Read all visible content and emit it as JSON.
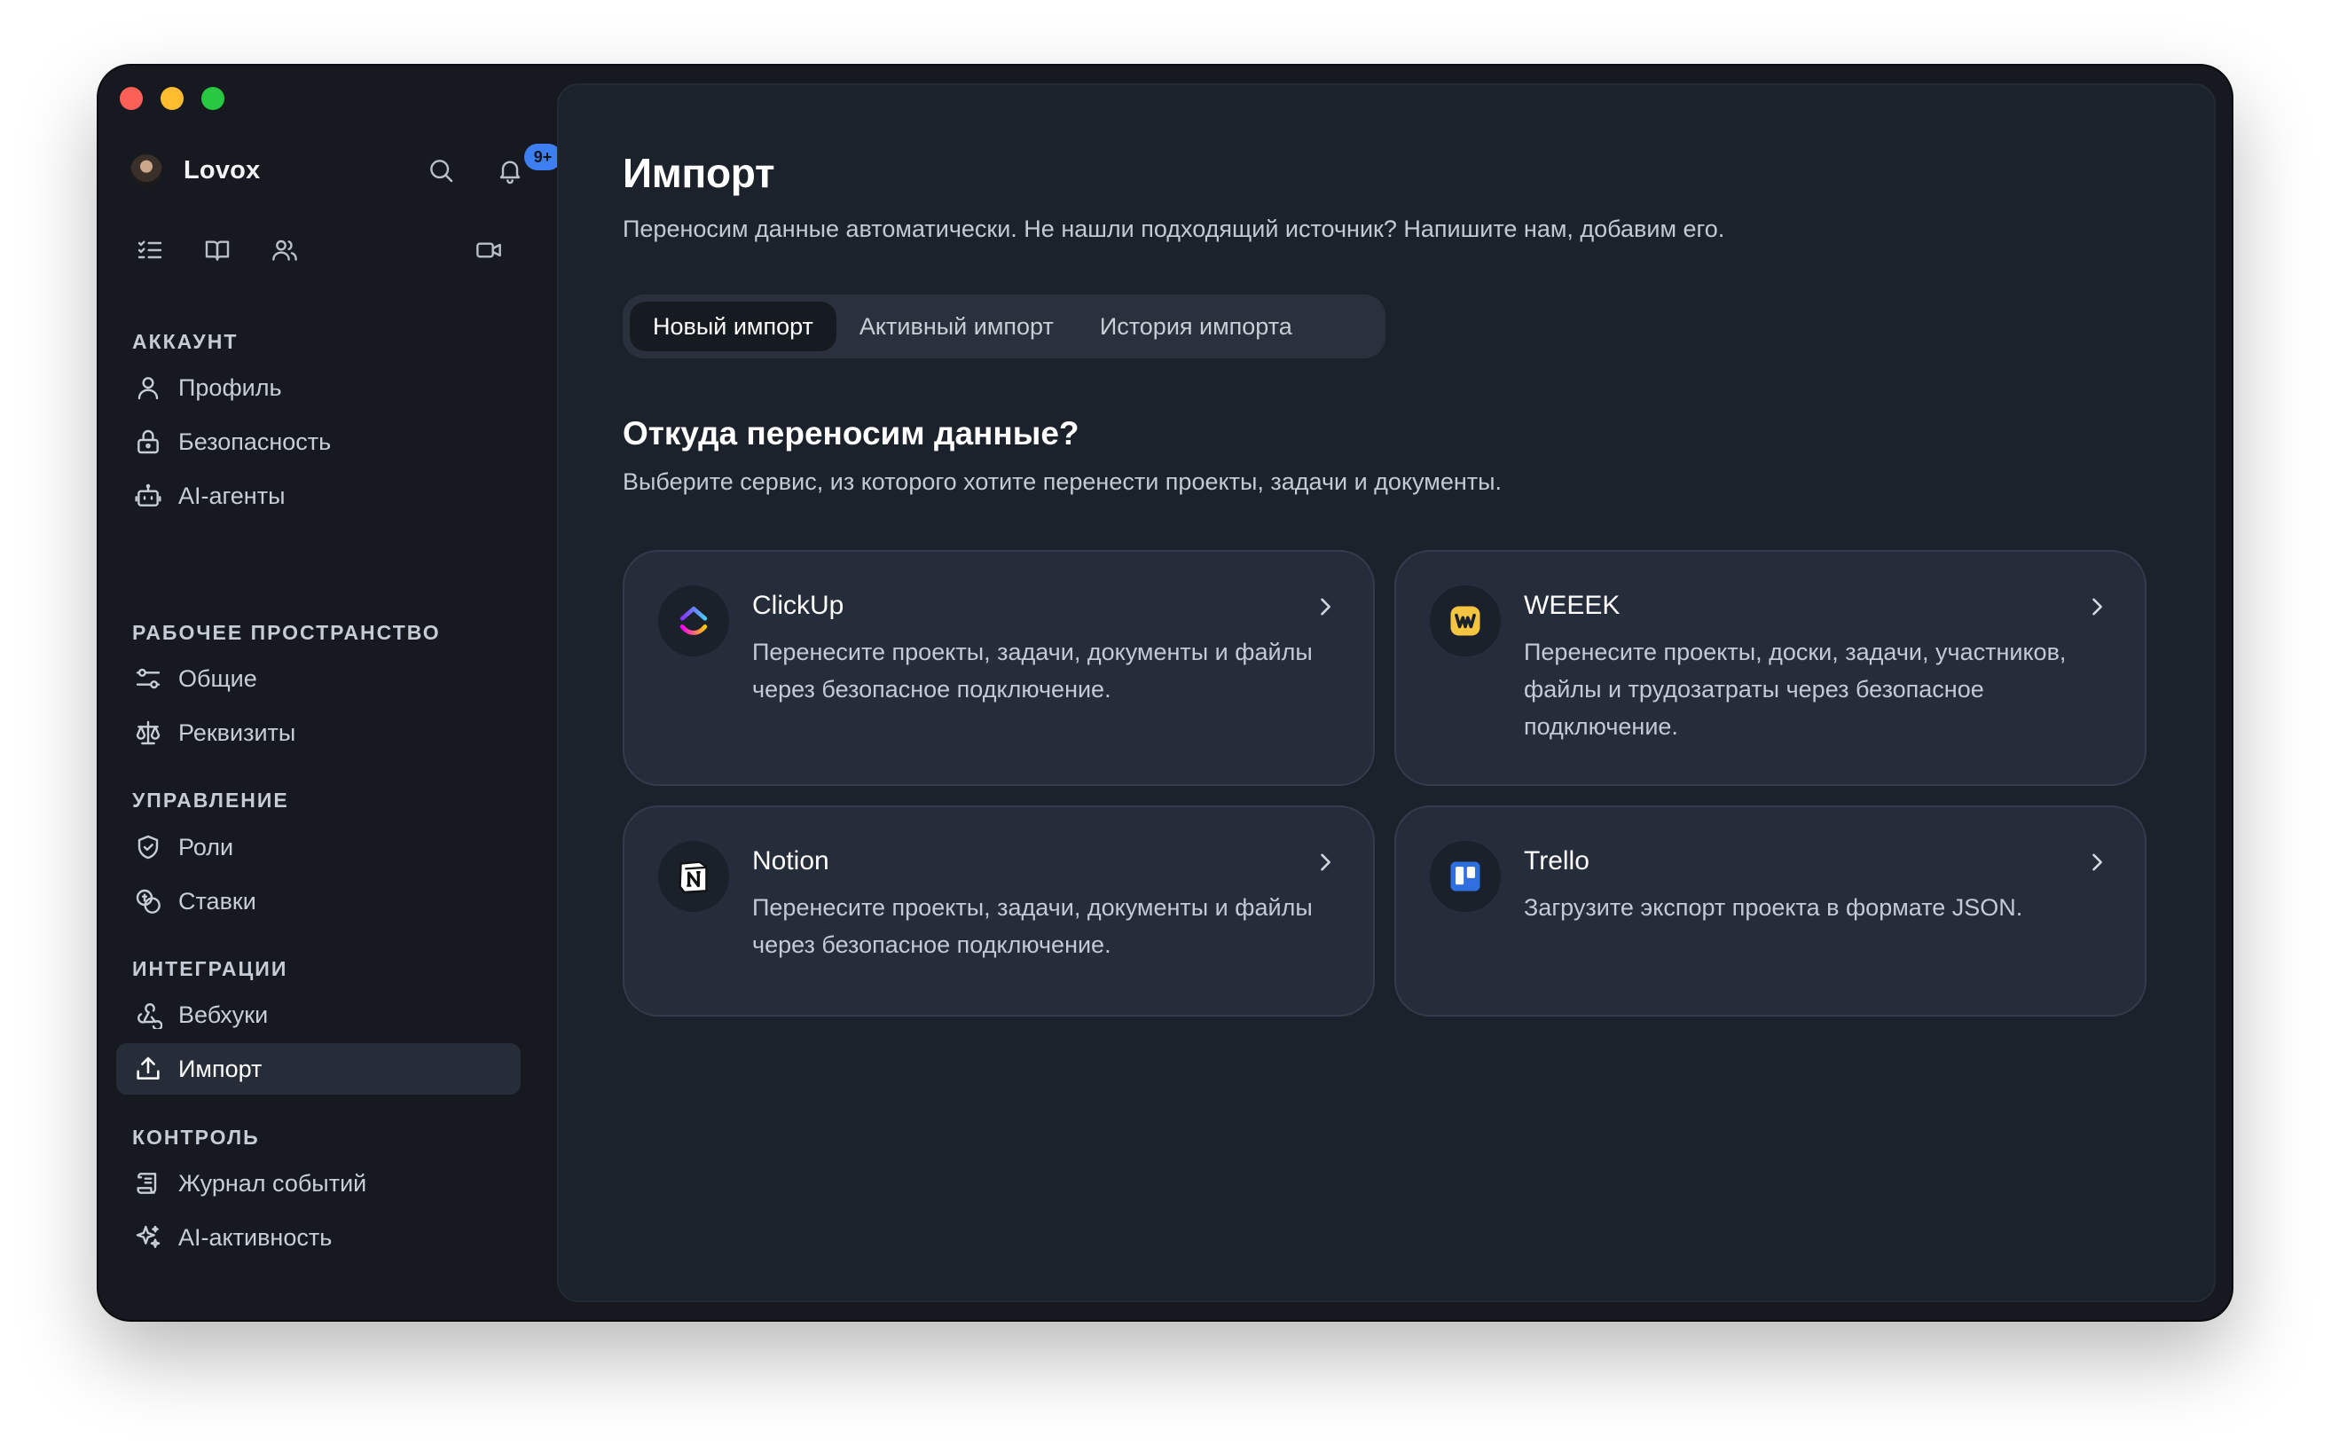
{
  "window": {
    "controls": [
      "close",
      "minimize",
      "maximize"
    ]
  },
  "sidebar": {
    "user": {
      "name": "Lovox"
    },
    "notifications_badge": "9+",
    "header_icons": [
      "search-icon",
      "bell-icon"
    ],
    "tool_icons": [
      "tasks-icon",
      "book-icon",
      "users-icon",
      "video-icon"
    ],
    "sections": [
      {
        "title": "АККАУНТ",
        "items": [
          {
            "label": "Профиль",
            "icon": "user-icon"
          },
          {
            "label": "Безопасность",
            "icon": "lock-icon"
          },
          {
            "label": "AI-агенты",
            "icon": "bot-icon"
          }
        ]
      },
      {
        "title": "РАБОЧЕЕ ПРОСТРАНСТВО",
        "items": [
          {
            "label": "Общие",
            "icon": "sliders-icon"
          },
          {
            "label": "Реквизиты",
            "icon": "scales-icon"
          }
        ]
      },
      {
        "title": "УПРАВЛЕНИЕ",
        "items": [
          {
            "label": "Роли",
            "icon": "shield-check-icon"
          },
          {
            "label": "Ставки",
            "icon": "coins-icon"
          }
        ]
      },
      {
        "title": "ИНТЕГРАЦИИ",
        "items": [
          {
            "label": "Вебхуки",
            "icon": "webhook-icon"
          },
          {
            "label": "Импорт",
            "icon": "upload-icon",
            "active": true
          }
        ]
      },
      {
        "title": "КОНТРОЛЬ",
        "items": [
          {
            "label": "Журнал событий",
            "icon": "scroll-icon"
          },
          {
            "label": "AI-активность",
            "icon": "sparkles-icon"
          }
        ]
      }
    ]
  },
  "main": {
    "title": "Импорт",
    "subtitle": "Переносим данные автоматически. Не нашли подходящий источник? Напишите нам, добавим его.",
    "tabs": [
      {
        "label": "Новый импорт",
        "active": true
      },
      {
        "label": "Активный импорт",
        "active": false
      },
      {
        "label": "История импорта",
        "active": false
      }
    ],
    "section_heading": "Откуда переносим данные?",
    "section_sub": "Выберите сервис, из которого хотите перенести проекты, задачи и документы.",
    "sources": [
      {
        "name": "ClickUp",
        "icon": "clickup-logo",
        "description": "Перенесите проекты, задачи, документы и файлы через безопасное подключение."
      },
      {
        "name": "WEEEK",
        "icon": "weeek-logo",
        "description": "Перенесите проекты, доски, задачи, участников, файлы и трудозатраты через безопасное подключение."
      },
      {
        "name": "Notion",
        "icon": "notion-logo",
        "description": "Перенесите проекты, задачи, документы и файлы через безопасное подключение."
      },
      {
        "name": "Trello",
        "icon": "trello-logo",
        "description": "Загрузите экспорт проекта в формате JSON."
      }
    ]
  },
  "colors": {
    "accent": "#3d7ff0",
    "window_bg": "#161a20",
    "panel_bg": "#1c222b",
    "card_bg": "#252d3b",
    "weeek_yellow": "#f5c542",
    "trello_blue": "#2f6fe0"
  }
}
